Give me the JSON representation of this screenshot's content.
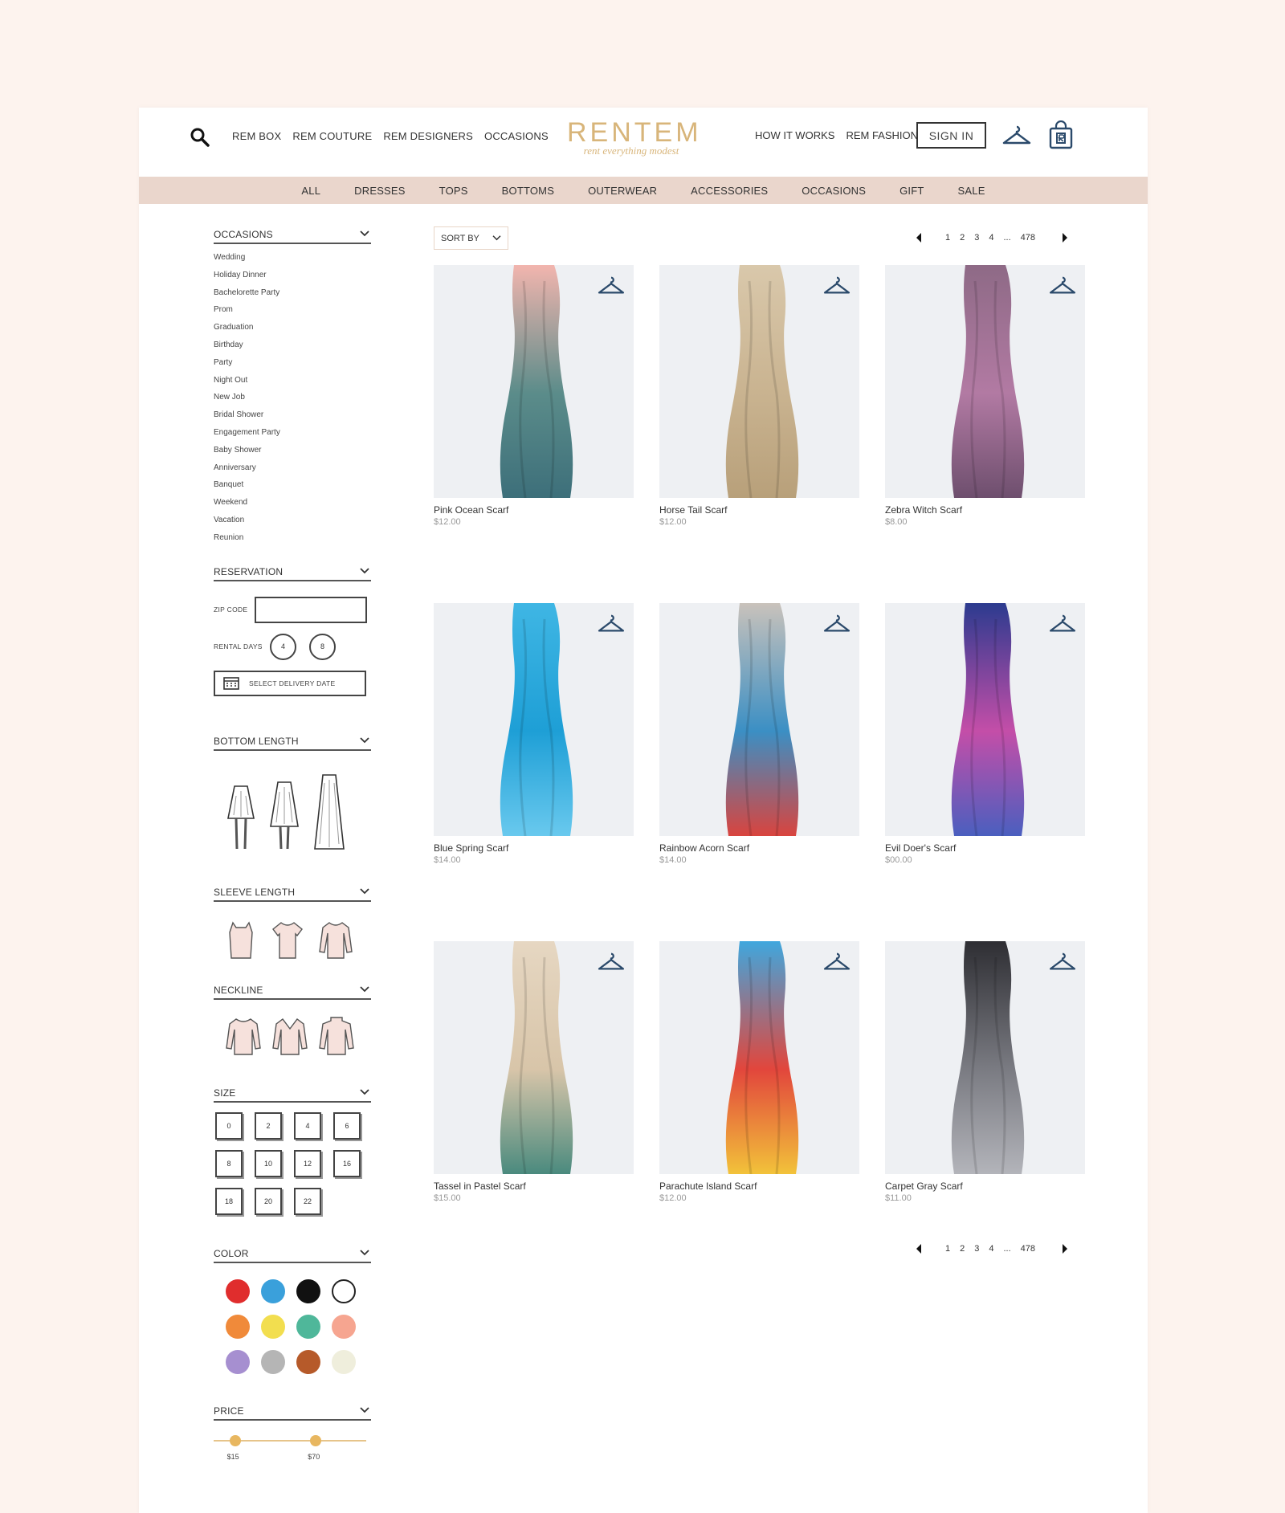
{
  "header": {
    "nav_left": [
      "REM BOX",
      "REM COUTURE",
      "REM DESIGNERS",
      "OCCASIONS"
    ],
    "logo": {
      "wordmark": "RENTEM",
      "tagline": "rent everything modest"
    },
    "nav_right": [
      "HOW IT WORKS",
      "REM FASHION"
    ],
    "signin_label": "SIGN IN"
  },
  "categories": [
    "ALL",
    "DRESSES",
    "TOPS",
    "BOTTOMS",
    "OUTERWEAR",
    "ACCESSORIES",
    "OCCASIONS",
    "GIFT",
    "SALE"
  ],
  "sidebar": {
    "occasions": {
      "title": "OCCASIONS",
      "items": [
        "Wedding",
        "Holiday Dinner",
        "Bachelorette Party",
        "Prom",
        "Graduation",
        "Birthday",
        "Party",
        "Night Out",
        "New Job",
        "Bridal Shower",
        "Engagement Party",
        "Baby Shower",
        "Anniversary",
        "Banquet",
        "Weekend",
        "Vacation",
        "Reunion"
      ]
    },
    "reservation": {
      "title": "RESERVATION",
      "zip_label": "ZIP CODE",
      "zip_value": "",
      "rental_days_label": "RENTAL DAYS",
      "rental_days": [
        "4",
        "8"
      ],
      "delivery_label": "SELECT DELIVERY DATE"
    },
    "bottom_length": {
      "title": "BOTTOM LENGTH"
    },
    "sleeve_length": {
      "title": "SLEEVE LENGTH"
    },
    "neckline": {
      "title": "NECKLINE"
    },
    "size": {
      "title": "SIZE",
      "options": [
        "0",
        "2",
        "4",
        "6",
        "8",
        "10",
        "12",
        "16",
        "18",
        "20",
        "22"
      ]
    },
    "color": {
      "title": "COLOR",
      "swatches": [
        "#e02d2d",
        "#3aa0db",
        "#111111",
        "#ffffff",
        "#f08a3a",
        "#f2de4f",
        "#4fb79a",
        "#f6a590",
        "#a68fd0",
        "#b5b5b5",
        "#b65a2a",
        "#efeedc"
      ]
    },
    "price": {
      "title": "PRICE",
      "min_label": "$15",
      "max_label": "$70",
      "min_fraction": 0.14,
      "max_fraction": 0.67
    }
  },
  "main": {
    "sort_label": "SORT BY",
    "pager": {
      "pages": [
        "1",
        "2",
        "3",
        "4"
      ],
      "ellipsis": "...",
      "last": "478"
    },
    "products": [
      {
        "name": "Pink Ocean Scarf",
        "price": "$12.00",
        "colors": [
          "#f2b5ae",
          "#5b8c8a",
          "#3d6f7a"
        ]
      },
      {
        "name": "Horse Tail Scarf",
        "price": "$12.00",
        "colors": [
          "#d9c8ab",
          "#c9b390",
          "#b8a07a"
        ]
      },
      {
        "name": "Zebra Witch Scarf",
        "price": "$8.00",
        "colors": [
          "#8e6a86",
          "#b27aa3",
          "#6e4f6e"
        ]
      },
      {
        "name": "Blue Spring Scarf",
        "price": "$14.00",
        "colors": [
          "#3fb6e4",
          "#1e9fd6",
          "#69c9ee"
        ]
      },
      {
        "name": "Rainbow Acorn Scarf",
        "price": "$14.00",
        "colors": [
          "#c9c2bb",
          "#3b8fc4",
          "#d9443e"
        ]
      },
      {
        "name": "Evil Doer's Scarf",
        "price": "$00.00",
        "colors": [
          "#2c3b8f",
          "#c44ea8",
          "#4a5fbf"
        ]
      },
      {
        "name": "Tassel in Pastel Scarf",
        "price": "$15.00",
        "colors": [
          "#e6d7c2",
          "#d8c5a9",
          "#4a8a7e"
        ]
      },
      {
        "name": "Parachute Island Scarf",
        "price": "$12.00",
        "colors": [
          "#3fa7de",
          "#e2463c",
          "#f2c23a"
        ]
      },
      {
        "name": "Carpet Gray Scarf",
        "price": "$11.00",
        "colors": [
          "#2e2e33",
          "#7a7b82",
          "#b3b4ba"
        ]
      }
    ]
  }
}
